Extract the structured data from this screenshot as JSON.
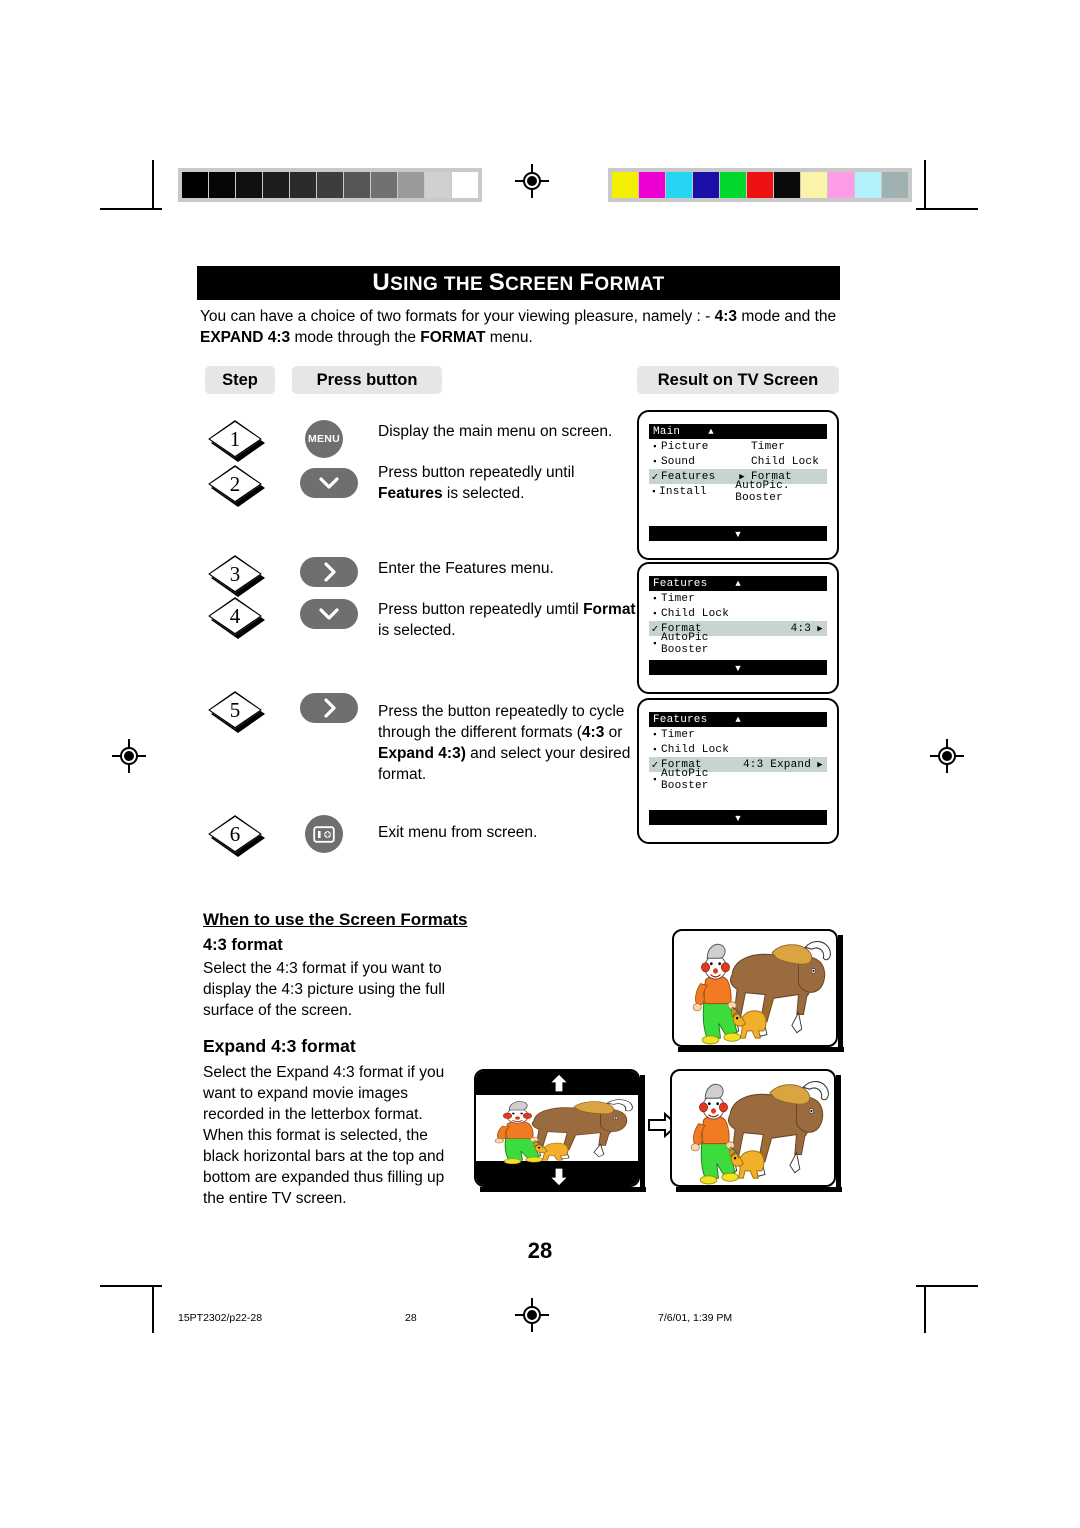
{
  "header": {
    "title_first_cap": "U",
    "title_rest_1": "SING THE ",
    "title_cap2": "S",
    "title_rest_2": "CREEN ",
    "title_cap3": "F",
    "title_rest_3": "ORMAT",
    "title_full": "USING THE SCREEN FORMAT"
  },
  "intro": {
    "line1_a": "You can have a choice of two formats for your viewing pleasure, namely : - ",
    "line1_b": "4:3",
    "line1_c": " mode and the",
    "line2_a": "EXPAND 4:3",
    "line2_b": " mode through the ",
    "line2_c": "FORMAT",
    "line2_d": " menu."
  },
  "table_headers": {
    "step": "Step",
    "press_button": "Press button",
    "result": "Result on TV Screen"
  },
  "steps": [
    {
      "number": "1",
      "button_type": "circle",
      "button_label": "MENU",
      "button_icon": "menu-button",
      "text_a": "Display the main menu on screen.",
      "text_bold": "",
      "text_b": ""
    },
    {
      "number": "2",
      "button_type": "pill",
      "button_label": "",
      "button_icon": "chevron-down-icon",
      "text_a": "Press button repeatedly until ",
      "text_bold": "Features",
      "text_b": " is selected."
    },
    {
      "number": "3",
      "button_type": "pill",
      "button_label": "",
      "button_icon": "chevron-right-icon",
      "text_a": "Enter the Features menu.",
      "text_bold": "",
      "text_b": ""
    },
    {
      "number": "4",
      "button_type": "pill",
      "button_label": "",
      "button_icon": "chevron-down-icon",
      "text_a": "Press button repeatedly umtil ",
      "text_bold": "Format",
      "text_b": " is selected."
    },
    {
      "number": "5",
      "button_type": "pill",
      "button_label": "",
      "button_icon": "chevron-right-icon",
      "text_a": "Press the button repeatedly to cycle through the different formats (",
      "text_bold": "4:3",
      "text_b": " or ",
      "text_bold2": "Expand 4:3)",
      "text_c": " and select your desired format."
    },
    {
      "number": "6",
      "button_type": "circle",
      "button_label": "",
      "button_icon": "info-exit-icon",
      "text_a": "Exit menu from screen.",
      "text_bold": "",
      "text_b": ""
    }
  ],
  "tv_screens": [
    {
      "menu_title": "Main",
      "up_arrow": "▲",
      "down_arrow": "▼",
      "rows": [
        {
          "marker": "▪",
          "label": "Picture",
          "arrow": "",
          "col2": "Timer",
          "selected": false
        },
        {
          "marker": "▪",
          "label": "Sound",
          "arrow": "",
          "col2": "Child Lock",
          "selected": false
        },
        {
          "marker": "✓",
          "label": "Features",
          "arrow": "▶",
          "col2": "Format",
          "selected": true
        },
        {
          "marker": "▪",
          "label": "Install",
          "arrow": "",
          "col2": "AutoPic. Booster",
          "selected": false
        }
      ]
    },
    {
      "menu_title": "Features",
      "up_arrow": "▲",
      "down_arrow": "▼",
      "rows": [
        {
          "marker": "▪",
          "label": "Timer",
          "value": "",
          "arrow": "",
          "selected": false
        },
        {
          "marker": "▪",
          "label": "Child Lock",
          "value": "",
          "arrow": "",
          "selected": false
        },
        {
          "marker": "✓",
          "label": "Format",
          "value": "4:3",
          "arrow": "▶",
          "selected": true
        },
        {
          "marker": "▪",
          "label": "AutoPic Booster",
          "value": "",
          "arrow": "",
          "selected": false
        }
      ]
    },
    {
      "menu_title": "Features",
      "up_arrow": "▲",
      "down_arrow": "▼",
      "rows": [
        {
          "marker": "▪",
          "label": "Timer",
          "value": "",
          "arrow": "",
          "selected": false
        },
        {
          "marker": "▪",
          "label": "Child Lock",
          "value": "",
          "arrow": "",
          "selected": false
        },
        {
          "marker": "✓",
          "label": "Format",
          "value": "4:3 Expand",
          "arrow": "▶",
          "selected": true
        },
        {
          "marker": "▪",
          "label": "AutoPic Booster",
          "value": "",
          "arrow": "",
          "selected": false
        }
      ]
    }
  ],
  "bottom": {
    "heading": "When to use the Screen Formats",
    "sub1": "4:3 format",
    "para1": "Select the 4:3 format if you want to display the 4:3 picture using the full surface of the screen.",
    "sub2": "Expand 4:3 format",
    "para2": "Select the Expand 4:3 format if you want to expand movie images recorded in the letterbox format. When this format is selected, the black horizontal bars at the top and bottom are expanded thus filling up the entire TV screen."
  },
  "page_number": "28",
  "footer": {
    "doc_id": "15PT2302/p22-28",
    "page": "28",
    "timestamp": "7/6/01, 1:39 PM"
  },
  "colors": {
    "grayscale_ramp": [
      "#000000",
      "#060606",
      "#101010",
      "#1c1c1c",
      "#2b2b2b",
      "#3d3d3d",
      "#565656",
      "#717171",
      "#9a9a9a",
      "#d0d0d0",
      "#ffffff"
    ],
    "color_bars": [
      "#f2ef00",
      "#ec00d2",
      "#25d5f2",
      "#1b0fa8",
      "#00d82e",
      "#ee1111",
      "#0a0a0a",
      "#fbf3a8",
      "#ff9ce8",
      "#b4f2fb",
      "#9fb1b0"
    ],
    "osd_highlight": "#c7d4cd",
    "button_gray": "#6f6f6f",
    "header_gray": "#e6e6e6"
  }
}
